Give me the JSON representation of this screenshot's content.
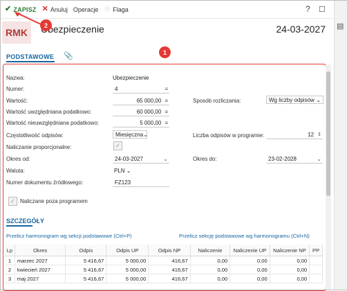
{
  "toolbar": {
    "save_label": "ZAPISZ",
    "cancel_label": "Anuluj",
    "operations_label": "Operacje",
    "flag_label": "Flaga",
    "help_label": "?"
  },
  "header": {
    "logo": "RMK",
    "title": "Ubezpieczenie",
    "date": "24-03-2027"
  },
  "tabs": {
    "basic": "PODSTAWOWE"
  },
  "badges": {
    "one": "1",
    "two": "2"
  },
  "form": {
    "name_label": "Nazwa:",
    "name_value": "Ubezpieczenie",
    "number_label": "Numer:",
    "number_value": "4",
    "value_label": "Wartość:",
    "value_value": "65 000,00",
    "taxable_label": "Wartość uwzględniana podatkowo:",
    "taxable_value": "60 000,00",
    "nontaxable_label": "Wartość nieuwzględniana podatkowo:",
    "nontaxable_value": "5 000,00",
    "frequency_label": "Częstotliwość odpisów:",
    "frequency_value": "Miesięczna",
    "proportional_label": "Naliczanie proporcjonalne:",
    "from_label": "Okres od:",
    "from_value": "24-03-2027",
    "currency_label": "Waluta:",
    "currency_value": "PLN",
    "docnum_label": "Numer dokumentu źródłowego:",
    "docnum_value": "FZ123",
    "method_label": "Sposób rozliczania:",
    "method_value": "Wg liczby odpisów",
    "count_label": "Liczba odpisów w programie:",
    "count_value": "12",
    "to_label": "Okres do:",
    "to_value": "23-02-2028",
    "outside_label": "Naliczane poza programem"
  },
  "details": {
    "title": "SZCZEGÓŁY",
    "link_left": "Przelicz harmonogram wg sekcji podstawowe (Ctrl+P)",
    "link_right": "Przelicz sekcję podstawowe wg harmonogramu (Ctrl+N)",
    "columns": [
      "Lp",
      "Okres",
      "Odpis",
      "Odpis UP",
      "Odpis NP",
      "Naliczenie",
      "Naliczenie UP",
      "Naliczenie NP",
      "PP"
    ],
    "rows": [
      {
        "lp": "1",
        "okres": "marzec 2027",
        "odpis": "5 416,67",
        "odpis_up": "5 000,00",
        "odpis_np": "416,67",
        "nal": "0,00",
        "nal_up": "0,00",
        "nal_np": "0,00"
      },
      {
        "lp": "2",
        "okres": "kwiecień 2027",
        "odpis": "5 416,67",
        "odpis_up": "5 000,00",
        "odpis_np": "416,67",
        "nal": "0,00",
        "nal_up": "0,00",
        "nal_np": "0,00"
      },
      {
        "lp": "3",
        "okres": "maj 2027",
        "odpis": "5 416,67",
        "odpis_up": "5 000,00",
        "odpis_np": "416,67",
        "nal": "0,00",
        "nal_up": "0,00",
        "nal_np": "0,00"
      }
    ]
  },
  "colors": {
    "accent": "#1565a0",
    "highlight": "#e53935",
    "save": "#2e7d32"
  }
}
